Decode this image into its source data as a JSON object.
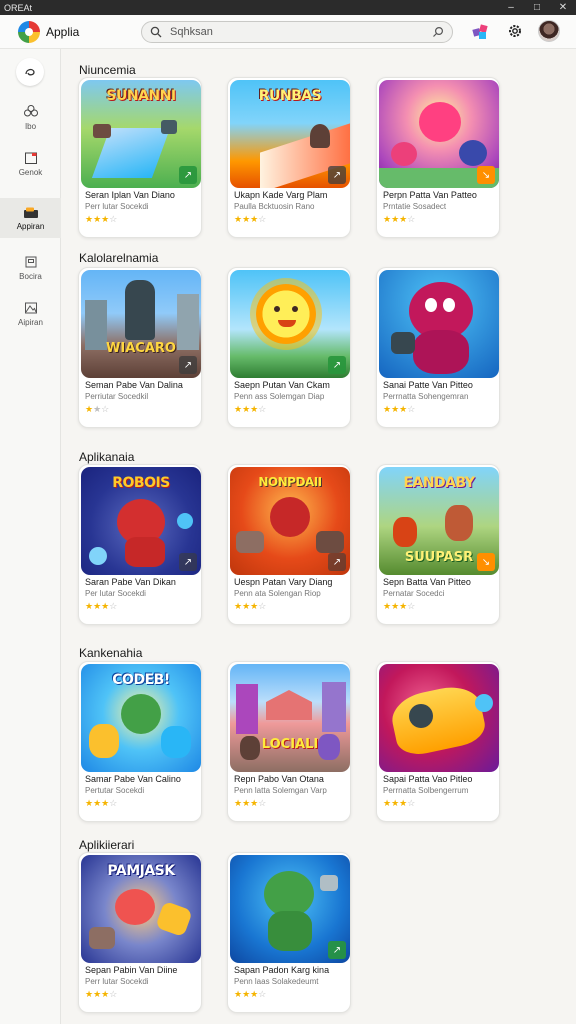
{
  "window": {
    "title": "OREAt"
  },
  "header": {
    "app_title": "Applia",
    "search_placeholder": "Sqhksan",
    "icons": [
      "search-icon",
      "mic-icon",
      "apps-icon",
      "settings-icon",
      "avatar"
    ]
  },
  "sidebar": {
    "items": [
      {
        "label": "",
        "icon": "home-icon"
      },
      {
        "label": "Ibo",
        "icon": "flower-icon"
      },
      {
        "label": "Genok",
        "icon": "calendar-icon"
      },
      {
        "label": "Appiran",
        "icon": "apps-folder-icon",
        "active": true
      },
      {
        "label": "Bocira",
        "icon": "window-icon"
      },
      {
        "label": "Aipiran",
        "icon": "mountain-icon"
      }
    ]
  },
  "sections": [
    {
      "title": "Niuncemia",
      "cards": [
        {
          "title": "Seran Iplan Van Diano",
          "sub": "Perr lutar Socekdi",
          "rating": 3,
          "art": "racing"
        },
        {
          "title": "Ukapn Kade Varg Plam",
          "sub": "Paulla Bcktuosin Rano",
          "rating": 3,
          "art": "runner"
        },
        {
          "title": "Perpn Patta Van Patteo",
          "sub": "Prntatie Sosadect",
          "rating": 3,
          "art": "monsters-pink"
        }
      ]
    },
    {
      "title": "Kalolarelnamia",
      "cards": [
        {
          "title": "Seman Pabe Van Dalina",
          "sub": "Perriutar Socedkil",
          "rating": 1.5,
          "art": "hero-city"
        },
        {
          "title": "Saepn Putan Van Ckam",
          "sub": "Penn ass Solemgan Diap",
          "rating": 3,
          "art": "sun"
        },
        {
          "title": "Sanai Patte Van Pitteo",
          "sub": "Perrnatta Sohengemran",
          "rating": 3,
          "art": "bear-purple"
        }
      ]
    },
    {
      "title": "Aplikanaia",
      "cards": [
        {
          "title": "Saran Pabe Van Dikan",
          "sub": "Per lutar Socekdi",
          "rating": 3,
          "art": "robots"
        },
        {
          "title": "Uespn Patan Vary Diang",
          "sub": "Penn ata Solengan Riop",
          "rating": 3,
          "art": "monster-red"
        },
        {
          "title": "Sepn Batta Van Pitteo",
          "sub": "Pernatar Socedci",
          "rating": 3,
          "art": "fantasy"
        }
      ]
    },
    {
      "title": "Kankenahia",
      "cards": [
        {
          "title": "Samar Pabe Van Calino",
          "sub": "Pertutar Socekdi",
          "rating": 3,
          "art": "codeb"
        },
        {
          "title": "Repn Pabo Van Otana",
          "sub": "Penn latta Solemgan Varp",
          "rating": 3,
          "art": "town"
        },
        {
          "title": "Sapai Patta Vao Pitleo",
          "sub": "Perrnatta Solbengerrum",
          "rating": 3,
          "art": "controller"
        }
      ]
    },
    {
      "title": "Aplikiierari",
      "cards": [
        {
          "title": "Sepan Pabin Van Diine",
          "sub": "Perr lutar Socekdi",
          "rating": 3,
          "art": "pamjask"
        },
        {
          "title": "Sapan Padon Karg kina",
          "sub": "Penn laas Solakedeumt",
          "rating": 3,
          "art": "monster-green"
        }
      ]
    }
  ],
  "card_banners": {
    "racing": "SUNANNI",
    "runner": "RUNBAS",
    "hero-city": "WIACARO",
    "robots": "ROBOIS",
    "monster-red": "NONPDAII",
    "fantasy": "EANDABY",
    "fantasy2": "SUUPASR",
    "codeb": "CODEB!",
    "town": "LOCIALI",
    "pamjask": "PAMJASK"
  },
  "colors": {
    "accent": "#1e88e5",
    "star": "#f5b400",
    "badge": "#2e9a3c"
  }
}
